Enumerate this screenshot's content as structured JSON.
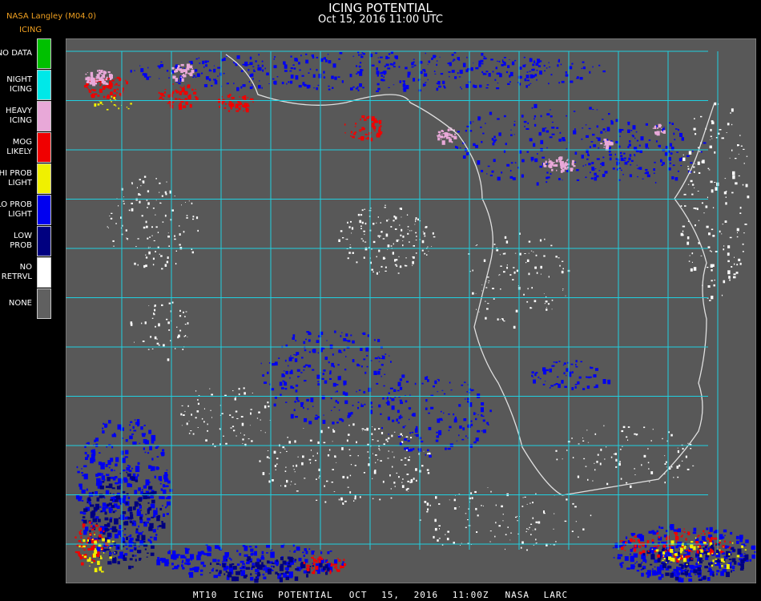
{
  "header": {
    "title": "ICING POTENTIAL",
    "subtitle": "Oct 15, 2016 11:00 UTC",
    "source": "NASA Langley (M04.0)",
    "legend_title": "ICING"
  },
  "legend": [
    {
      "line1": "NO DATA",
      "line2": "",
      "color": "#00c000"
    },
    {
      "line1": "NIGHT",
      "line2": "ICING",
      "color": "#00e8e8"
    },
    {
      "line1": "HEAVY",
      "line2": "ICING",
      "color": "#e8a8d8"
    },
    {
      "line1": "MOG",
      "line2": "LIKELY",
      "color": "#f00000"
    },
    {
      "line1": "HI PROB",
      "line2": "LIGHT",
      "color": "#f0f000"
    },
    {
      "line1": "LO PROB",
      "line2": "LIGHT",
      "color": "#0000f0"
    },
    {
      "line1": "LOW",
      "line2": "PROB",
      "color": "#000080"
    },
    {
      "line1": "NO",
      "line2": "RETRVL",
      "color": "#ffffff"
    },
    {
      "line1": "NONE",
      "line2": "",
      "color": "#606060"
    }
  ],
  "footer": {
    "product": "MT10",
    "name": "ICING POTENTIAL",
    "datetime": "OCT 15, 2016 11:00Z",
    "org": "NASA LARC"
  },
  "map": {
    "background_color": "#585858",
    "grid_color": "#20d0e0",
    "boundary_color": "#e0e0e0",
    "grid_cols": 14,
    "grid_rows": 11
  }
}
